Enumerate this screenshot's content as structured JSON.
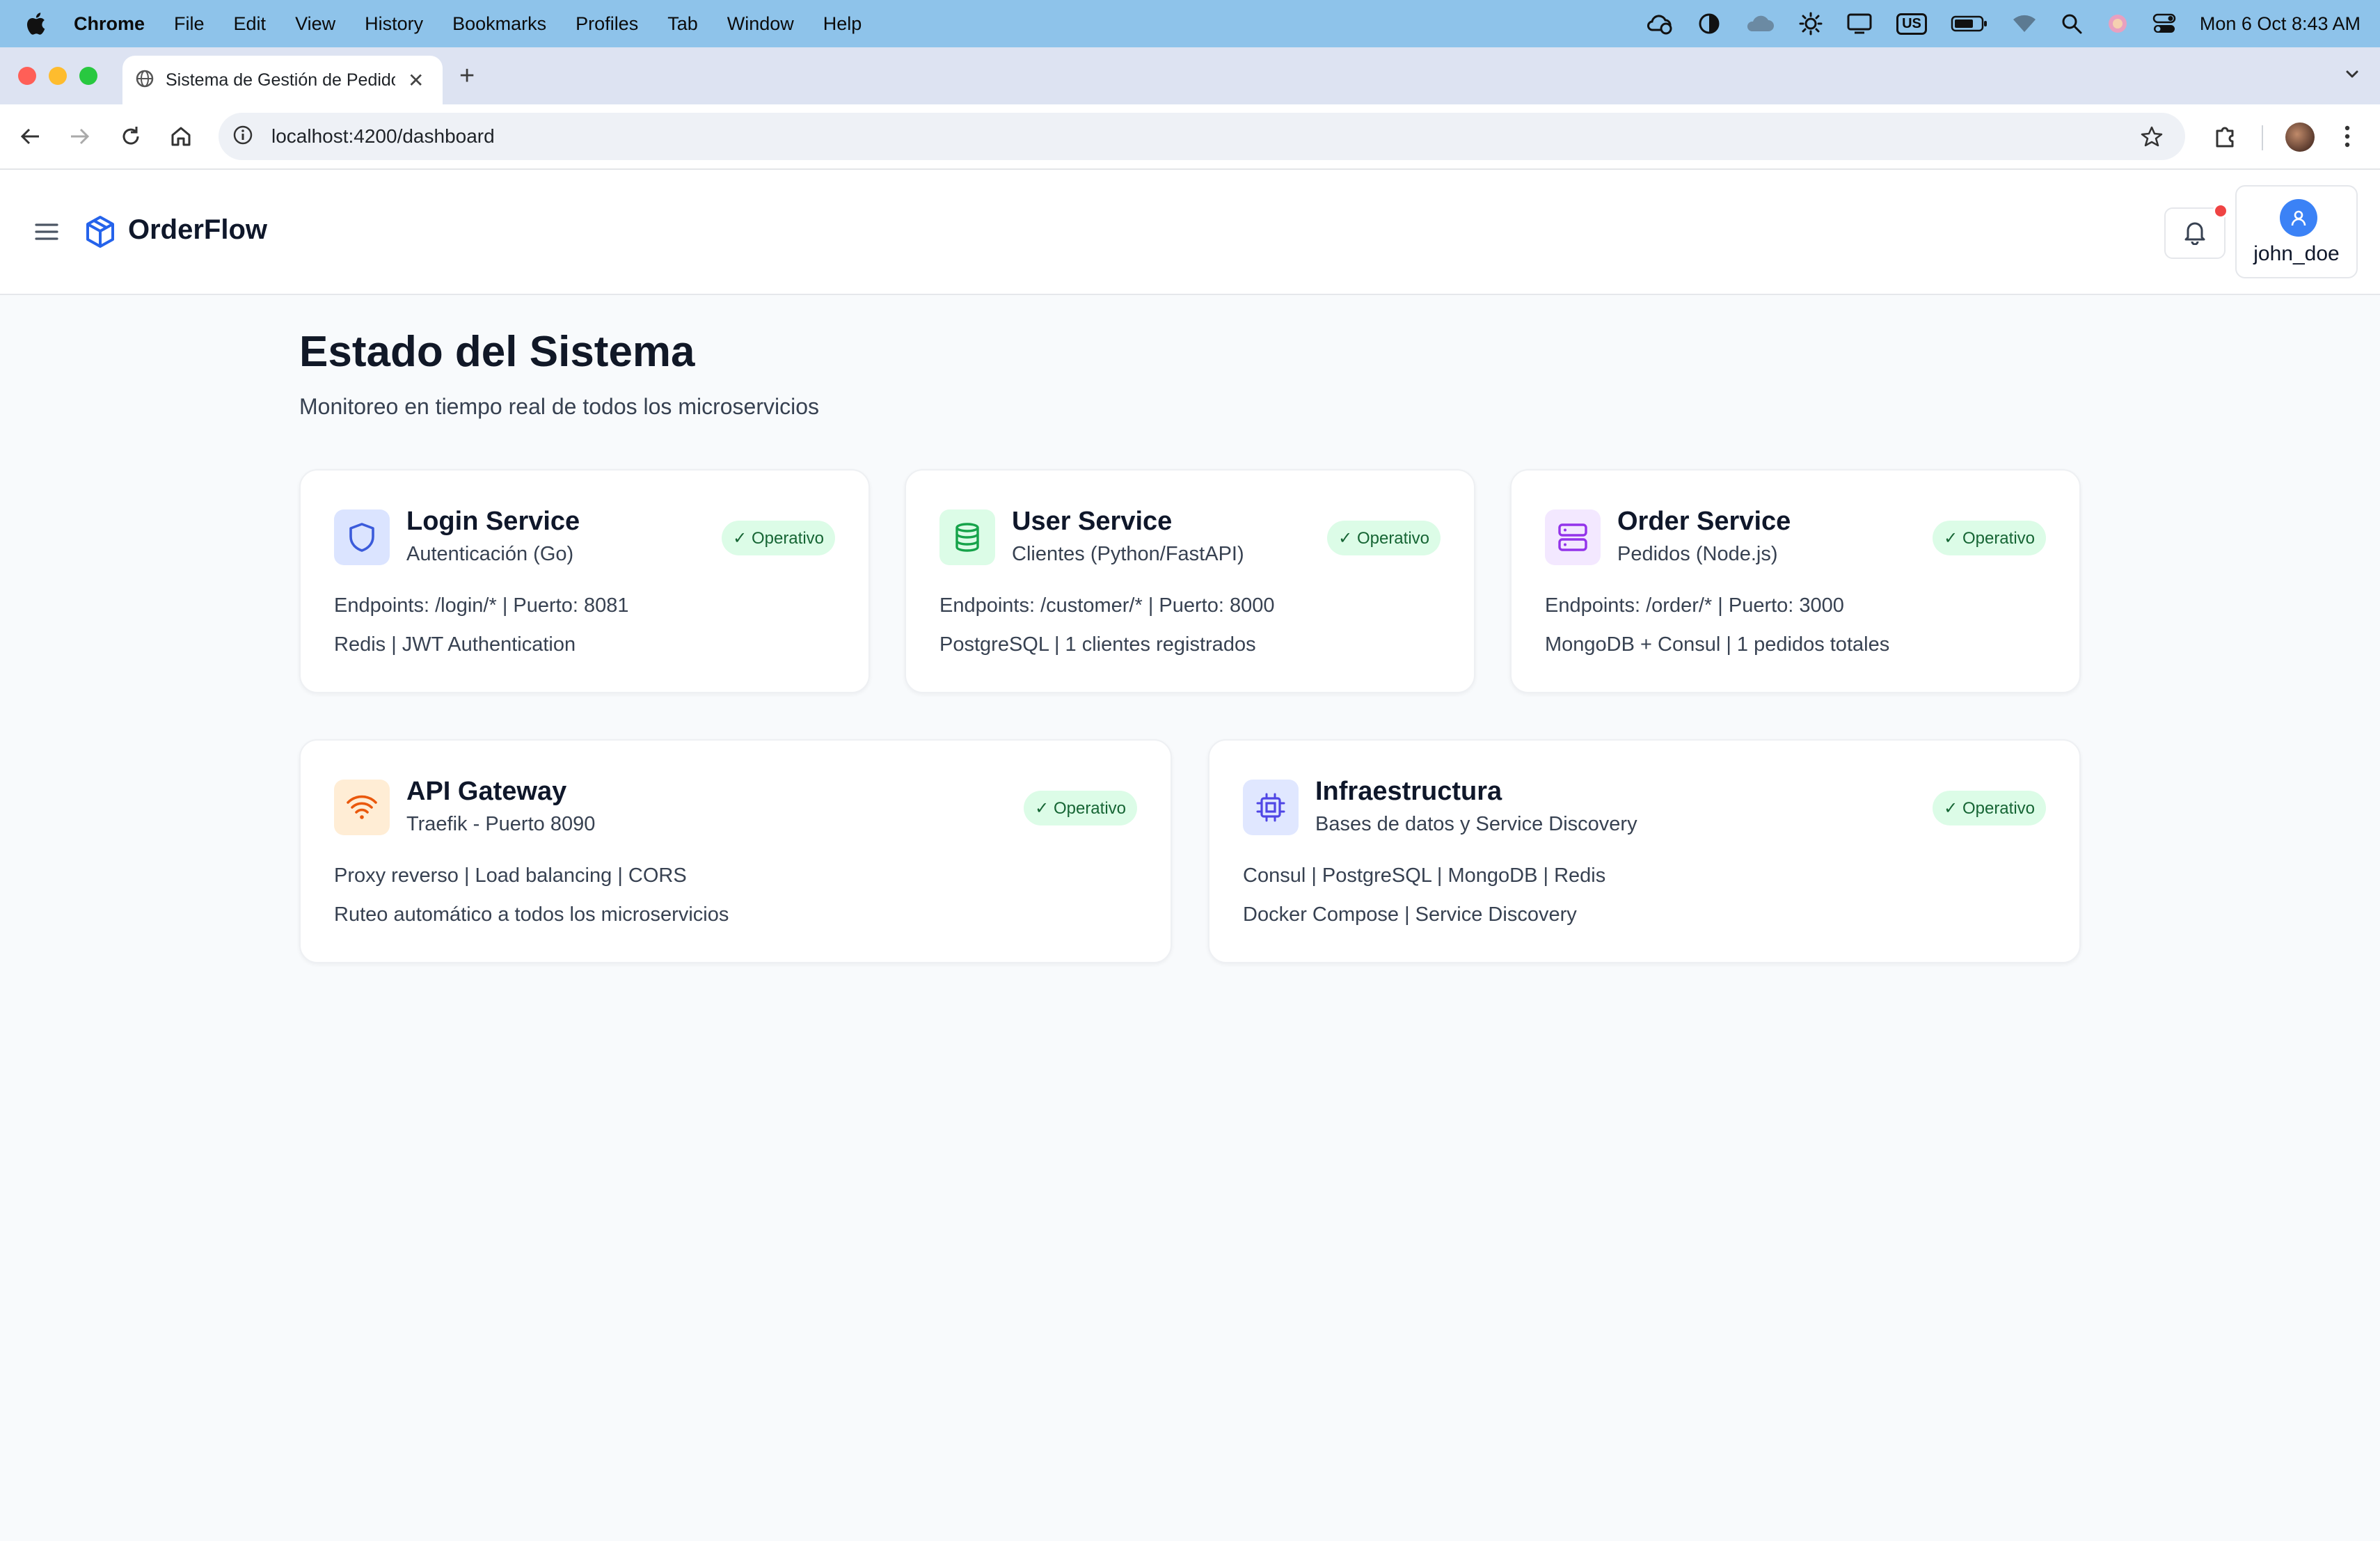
{
  "menubar": {
    "app_name": "Chrome",
    "items": [
      "File",
      "Edit",
      "View",
      "History",
      "Bookmarks",
      "Profiles",
      "Tab",
      "Window",
      "Help"
    ],
    "clock": "Mon 6 Oct  8:43 AM",
    "input_source": "US"
  },
  "browser": {
    "tab_title": "Sistema de Gestión de Pedidos",
    "url": "localhost:4200/dashboard"
  },
  "app": {
    "brand": "OrderFlow",
    "username": "john_doe"
  },
  "page": {
    "title": "Estado del Sistema",
    "subtitle": "Monitoreo en tiempo real de todos los microservicios"
  },
  "services": [
    {
      "title": "Login Service",
      "subtitle": "Autenticación (Go)",
      "status": "✓ Operativo",
      "line1": "Endpoints: /login/* | Puerto: 8081",
      "line2": "Redis | JWT Authentication",
      "icon": "shield-icon",
      "color": "#3b5bdb"
    },
    {
      "title": "User Service",
      "subtitle": "Clientes (Python/FastAPI)",
      "status": "✓ Operativo",
      "line1": "Endpoints: /customer/* | Puerto: 8000",
      "line2": "PostgreSQL | 1 clientes registrados",
      "icon": "database-icon",
      "color": "#16a34a"
    },
    {
      "title": "Order Service",
      "subtitle": "Pedidos (Node.js)",
      "status": "✓ Operativo",
      "line1": "Endpoints: /order/* | Puerto: 3000",
      "line2": "MongoDB + Consul | 1 pedidos totales",
      "icon": "server-icon",
      "color": "#9333ea"
    },
    {
      "title": "API Gateway",
      "subtitle": "Traefik - Puerto 8090",
      "status": "✓ Operativo",
      "line1": "Proxy reverso | Load balancing | CORS",
      "line2": "Ruteo automático a todos los microservicios",
      "icon": "wifi-icon",
      "color": "#ea580c"
    },
    {
      "title": "Infraestructura",
      "subtitle": "Bases de datos y Service Discovery",
      "status": "✓ Operativo",
      "line1": "Consul | PostgreSQL | MongoDB | Redis",
      "line2": "Docker Compose | Service Discovery",
      "icon": "cpu-icon",
      "color": "#4f46e5"
    }
  ],
  "colors": {
    "status_bg": "#dcfce7",
    "status_text": "#166534",
    "avatar": "#3b82f6",
    "notification_dot": "#ef4444"
  }
}
